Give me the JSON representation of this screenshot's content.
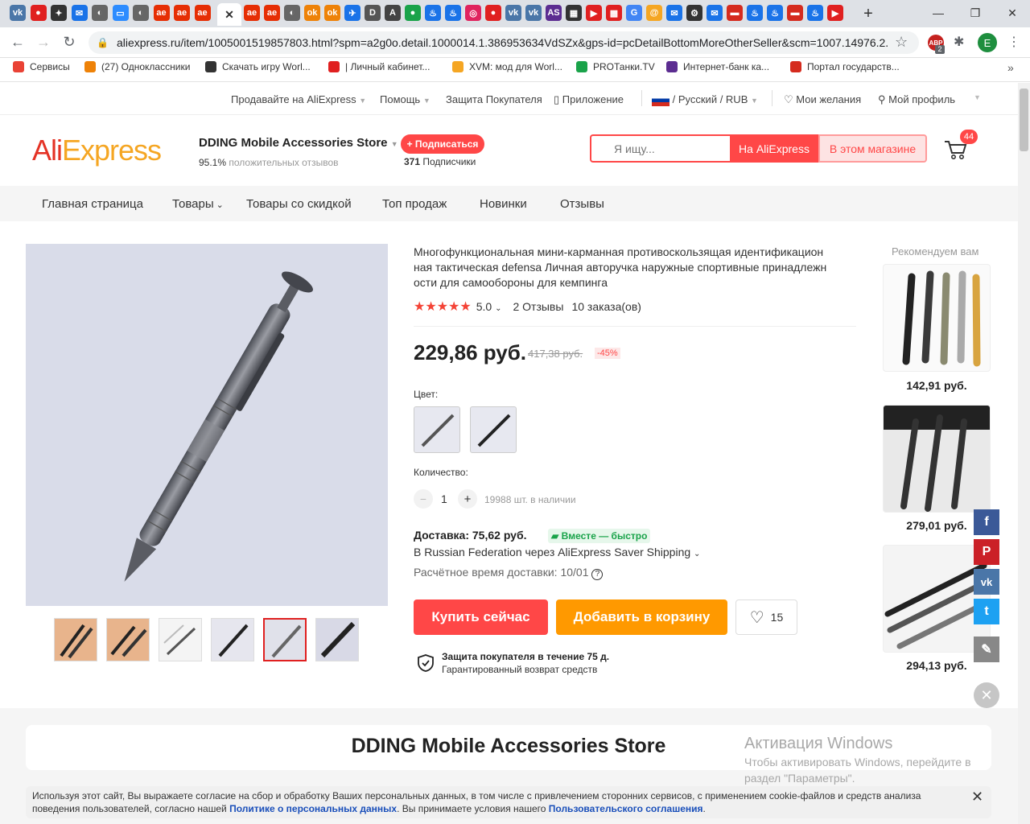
{
  "browser": {
    "tabs": [
      {
        "letter": "vk",
        "color": "#4a76a8"
      },
      {
        "letter": "●",
        "color": "#e02020"
      },
      {
        "letter": "✦",
        "color": "#333"
      },
      {
        "letter": "✉",
        "color": "#1a73e8"
      },
      {
        "letter": "◐",
        "color": "#666"
      },
      {
        "letter": "▭",
        "color": "#2d8cff"
      },
      {
        "letter": "◐",
        "color": "#666"
      },
      {
        "letter": "ae",
        "color": "#e62e04"
      },
      {
        "letter": "ae",
        "color": "#e62e04"
      },
      {
        "letter": "ae",
        "color": "#e62e04"
      }
    ],
    "tabs_right": [
      {
        "letter": "ae",
        "color": "#e62e04"
      },
      {
        "letter": "ae",
        "color": "#e62e04"
      },
      {
        "letter": "◐",
        "color": "#666"
      },
      {
        "letter": "ok",
        "color": "#ee8208"
      },
      {
        "letter": "ok",
        "color": "#ee8208"
      },
      {
        "letter": "✈",
        "color": "#1a73e8"
      },
      {
        "letter": "D",
        "color": "#555"
      },
      {
        "letter": "A",
        "color": "#444"
      },
      {
        "letter": "●",
        "color": "#1aa34a"
      },
      {
        "letter": "♨",
        "color": "#1a73e8"
      },
      {
        "letter": "♨",
        "color": "#1a73e8"
      },
      {
        "letter": "◎",
        "color": "#e0245e"
      },
      {
        "letter": "●",
        "color": "#e02020"
      },
      {
        "letter": "vk",
        "color": "#4a76a8"
      },
      {
        "letter": "vk",
        "color": "#4a76a8"
      },
      {
        "letter": "AS",
        "color": "#5c2d91"
      },
      {
        "letter": "▦",
        "color": "#333"
      },
      {
        "letter": "▶",
        "color": "#e02020"
      },
      {
        "letter": "▩",
        "color": "#e02020"
      },
      {
        "letter": "G",
        "color": "#4285f4"
      },
      {
        "letter": "@",
        "color": "#f5a623"
      },
      {
        "letter": "✉",
        "color": "#1a73e8"
      },
      {
        "letter": "⚙",
        "color": "#333"
      },
      {
        "letter": "✉",
        "color": "#1a73e8"
      },
      {
        "letter": "▬",
        "color": "#d52b1e"
      },
      {
        "letter": "♨",
        "color": "#1a73e8"
      },
      {
        "letter": "♨",
        "color": "#1a73e8"
      },
      {
        "letter": "▬",
        "color": "#d52b1e"
      },
      {
        "letter": "♨",
        "color": "#1a73e8"
      },
      {
        "letter": "▶",
        "color": "#e02020"
      }
    ],
    "active_tab_close": "✕",
    "new_tab": "+",
    "url": "aliexpress.ru/item/1005001519857803.html?spm=a2g0o.detail.1000014.1.386953634VdSZx&gps-id=pcDetailBottomMoreOtherSeller&scm=1007.14976.2...",
    "profile_letter": "E",
    "ext_badge": "2",
    "bookmarks": [
      {
        "label": "Сервисы",
        "color": "#e94235"
      },
      {
        "label": "(27) Одноклассники",
        "color": "#ee8208"
      },
      {
        "label": "Скачать игру Worl...",
        "color": "#333"
      },
      {
        "label": "| Личный кабинет...",
        "color": "#e02020"
      },
      {
        "label": "XVM: мод для Worl...",
        "color": "#f5a623"
      },
      {
        "label": "PROТанки.TV",
        "color": "#1aa34a"
      },
      {
        "label": "Интернет-банк ка...",
        "color": "#5c2d91"
      },
      {
        "label": "Портал государств...",
        "color": "#d52b1e"
      }
    ],
    "more_bookmarks": "»"
  },
  "topnav": {
    "sell": "Продавайте на AliExpress",
    "help": "Помощь",
    "protection": "Защита Покупателя",
    "app": "Приложение",
    "lang": "/ Русский /  RUB",
    "wishlist": "Мои желания",
    "profile": "Мой профиль"
  },
  "store": {
    "name": "DDING Mobile Accessories Store",
    "rating_value": "95.1%",
    "rating_text": "положительных отзывов",
    "subscribe": "+ Подписаться",
    "subscribers_count": "371",
    "subscribers_label": "Подписчики",
    "footer_name": "DDING Mobile Accessories Store"
  },
  "logo": {
    "ali": "Ali",
    "express": "Express"
  },
  "search": {
    "placeholder": "Я ищу...",
    "btn_aliexpress": "На AliExpress",
    "btn_store": "В этом магазине",
    "cart_count": "44"
  },
  "catnav": {
    "home": "Главная страница",
    "products": "Товары",
    "discount": "Товары со скидкой",
    "top": "Топ продаж",
    "new": "Новинки",
    "reviews": "Отзывы"
  },
  "product": {
    "title": "Многофункциональная мини-карманная противоскользящая идентификацион ная тактическая defensa Личная авторучка наружные спортивные принадлежн ости для самообороны для кемпинга",
    "title_lines": [
      "Многофункциональная мини-карманная противоскользящая идентификацион",
      "ная тактическая defensa Личная авторучка наружные спортивные принадлежн",
      "ости для самообороны для кемпинга"
    ],
    "rating": 5.0,
    "rating_label": "5.0",
    "reviews": "2 Отзывы",
    "orders": "10 заказа(ов)",
    "price": "229,86 руб.",
    "old_price": "417,38 руб.",
    "discount": "-45%",
    "color_label": "Цвет:",
    "qty_label": "Количество:",
    "qty_value": "1",
    "qty_minus": "−",
    "qty_plus": "+",
    "stock": "19988 шт. в наличии",
    "delivery_label": "Доставка: 75,62 руб.",
    "delivery_badge": "Вместе — быстро",
    "delivery_route": "В Russian Federation через AliExpress Saver Shipping",
    "delivery_time": "Расчётное время доставки: 10/01",
    "buy_now": "Купить сейчас",
    "add_cart": "Добавить в корзину",
    "wish_count": "15",
    "protection_title": "Защита покупателя в течение 75 д.",
    "protection_sub": "Гарантированный возврат средств"
  },
  "recommend": {
    "title": "Рекомендуем вам",
    "items": [
      {
        "price": "142,91 руб."
      },
      {
        "price": "279,01 руб."
      },
      {
        "price": "294,13 руб."
      }
    ]
  },
  "social": [
    "f",
    "P",
    "vk",
    "t",
    "✎"
  ],
  "windows": {
    "title": "Активация Windows",
    "line1": "Чтобы активировать Windows, перейдите в",
    "line2": "раздел \"Параметры\"."
  },
  "cookie": {
    "text1": "Используя этот сайт, Вы выражаете согласие на сбор и обработку Ваших персональных данных, в том числе с привлечением сторонних сервисов, с применением cookie-файлов и средств анализа",
    "text2a": "поведения пользователей, согласно нашей ",
    "link1": "Политике о персональных данных",
    "text2b": ". Вы принимаете условия нашего ",
    "link2": "Пользовательского соглашения",
    "text2c": "."
  },
  "colors": {
    "accent": "#ff4747",
    "orange": "#ff9900",
    "brand_orange": "#f5a623",
    "link": "#1a4fba"
  }
}
